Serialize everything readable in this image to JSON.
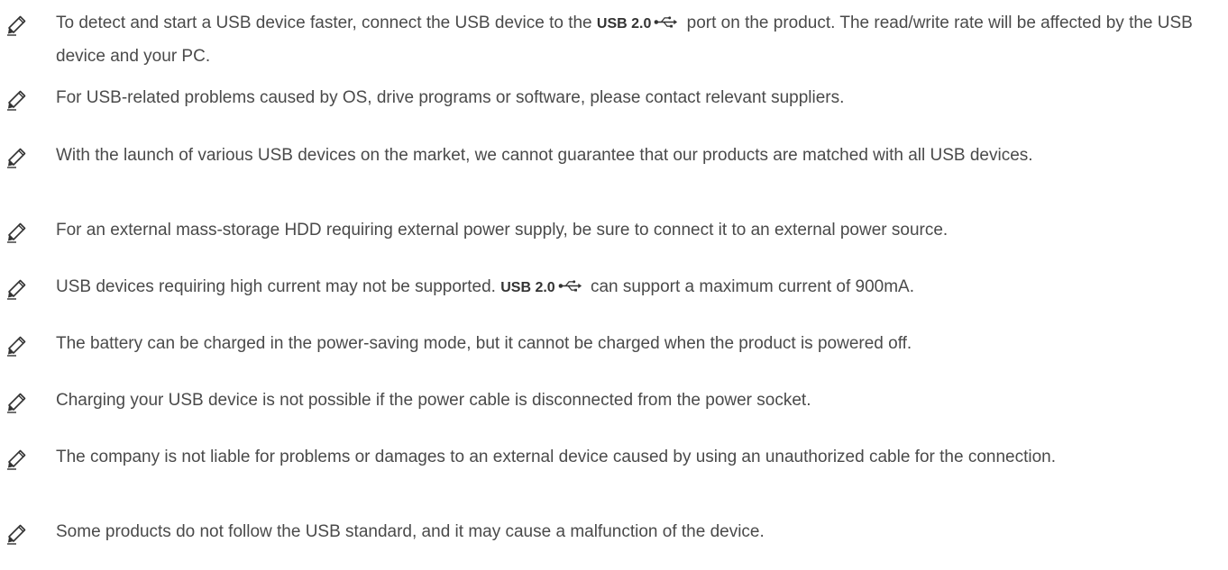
{
  "notes": [
    {
      "icon": "pencil-icon",
      "parts": [
        {
          "t": "To detect and start a USB device faster, connect the USB device to the "
        },
        {
          "usb": "USB 2.0"
        },
        {
          "t": " port on the product. The read/write rate will be affected by the USB device and your PC."
        }
      ]
    },
    {
      "icon": "pencil-icon",
      "parts": [
        {
          "t": "For USB-related problems caused by OS, drive programs or software, please contact relevant suppliers."
        }
      ]
    },
    {
      "icon": "pencil-icon",
      "parts": [
        {
          "t": "With the launch of various USB devices on the market, we cannot guarantee that our products are matched with all USB devices."
        }
      ]
    },
    {
      "icon": "pencil-icon",
      "parts": [
        {
          "t": "For an external mass-storage HDD requiring external power supply, be sure to connect it to an external power source."
        }
      ]
    },
    {
      "icon": "pencil-icon",
      "parts": [
        {
          "t": "USB devices requiring high current may not be supported. "
        },
        {
          "usb": "USB 2.0"
        },
        {
          "t": " can support a maximum current of 900mA."
        }
      ]
    },
    {
      "icon": "pencil-icon",
      "parts": [
        {
          "t": "The battery can be charged in the power-saving mode, but it cannot be charged when the product is powered off."
        }
      ]
    },
    {
      "icon": "pencil-icon",
      "parts": [
        {
          "t": "Charging your USB device is not possible if the power cable is disconnected from the power socket."
        }
      ]
    },
    {
      "icon": "pencil-icon",
      "parts": [
        {
          "t": "The company is not liable for problems or damages to an external device caused by using an unauthorized cable for the connection."
        }
      ]
    },
    {
      "icon": "pencil-icon",
      "parts": [
        {
          "t": "Some products do not follow the USB standard, and it may cause a malfunction of the device."
        }
      ]
    }
  ]
}
